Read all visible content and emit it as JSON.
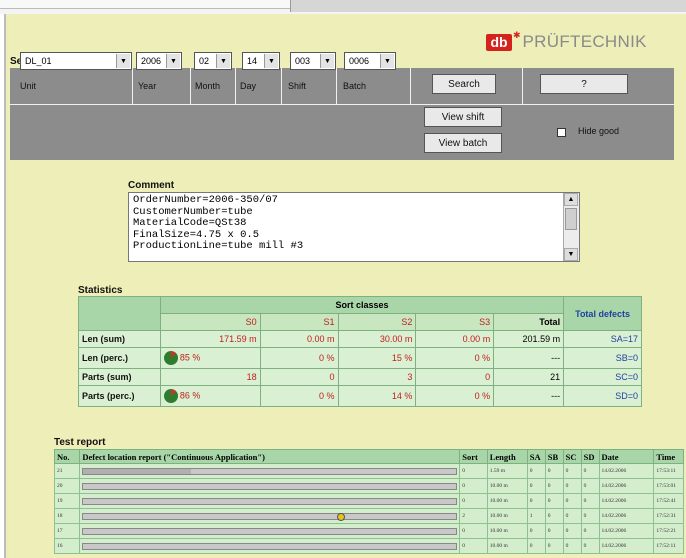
{
  "brand": {
    "logo_text": "db",
    "name": "PRÜFTECHNIK"
  },
  "selection": {
    "title": "Selection",
    "headers": {
      "unit": "Unit",
      "year": "Year",
      "month": "Month",
      "day": "Day",
      "shift": "Shift",
      "batch": "Batch"
    },
    "values": {
      "unit": "DL_01",
      "year": "2006",
      "month": "02",
      "day": "14",
      "shift": "003",
      "batch": "0006"
    },
    "buttons": {
      "search": "Search",
      "help": "?",
      "view_shift": "View shift",
      "view_batch": "View batch"
    },
    "hide_good": {
      "label": "Hide good",
      "checked": false
    }
  },
  "comment": {
    "label": "Comment",
    "text": "OrderNumber=2006-350/07\nCustomerNumber=tube\nMaterialCode=QSt38\nFinalSize=4.75 x 0.5\nProductionLine=tube mill #3"
  },
  "statistics": {
    "title": "Statistics",
    "sort_classes_label": "Sort classes",
    "total_defects_label": "Total defects",
    "columns": [
      "S0",
      "S1",
      "S2",
      "S3",
      "Total"
    ],
    "rows": [
      {
        "label": "Len (sum)",
        "values": [
          "171.59 m",
          "0.00 m",
          "30.00 m",
          "0.00 m",
          "201.59 m"
        ],
        "defects": "SA=17"
      },
      {
        "label": "Len (perc.)",
        "values": [
          "85 %",
          "0 %",
          "15 %",
          "0 %",
          "---"
        ],
        "defects": "SB=0"
      },
      {
        "label": "Parts (sum)",
        "values": [
          "18",
          "0",
          "3",
          "0",
          "21"
        ],
        "defects": "SC=0"
      },
      {
        "label": "Parts (perc.)",
        "values": [
          "86 %",
          "0 %",
          "14 %",
          "0 %",
          "---"
        ],
        "defects": "SD=0"
      }
    ]
  },
  "test_report": {
    "title": "Test report",
    "headers": [
      "No.",
      "Defect location report (\"Continuous Application\")",
      "Sort",
      "Length",
      "SA",
      "SB",
      "SC",
      "SD",
      "Date",
      "Time"
    ],
    "rows": [
      {
        "no": "21",
        "sort": "0",
        "length": "1.59 m",
        "sa": "0",
        "sb": "0",
        "sc": "0",
        "sd": "0",
        "date": "14.02.2006",
        "time": "17:53:11",
        "bar": 0.29,
        "dot": null
      },
      {
        "no": "20",
        "sort": "0",
        "length": "10.00 m",
        "sa": "0",
        "sb": "0",
        "sc": "0",
        "sd": "0",
        "date": "14.02.2006",
        "time": "17:53:01",
        "bar": 0,
        "dot": null
      },
      {
        "no": "19",
        "sort": "0",
        "length": "10.00 m",
        "sa": "0",
        "sb": "0",
        "sc": "0",
        "sd": "0",
        "date": "14.02.2006",
        "time": "17:52:41",
        "bar": 0,
        "dot": null
      },
      {
        "no": "18",
        "sort": "2",
        "length": "10.00 m",
        "sa": "1",
        "sb": "0",
        "sc": "0",
        "sd": "0",
        "date": "14.02.2006",
        "time": "17:52:31",
        "bar": 0,
        "dot": 0.68
      },
      {
        "no": "17",
        "sort": "0",
        "length": "10.00 m",
        "sa": "0",
        "sb": "0",
        "sc": "0",
        "sd": "0",
        "date": "14.02.2006",
        "time": "17:52:21",
        "bar": 0,
        "dot": null
      },
      {
        "no": "16",
        "sort": "0",
        "length": "10.00 m",
        "sa": "0",
        "sb": "0",
        "sc": "0",
        "sd": "0",
        "date": "14.02.2006",
        "time": "17:52:11",
        "bar": 0,
        "dot": null
      }
    ]
  }
}
